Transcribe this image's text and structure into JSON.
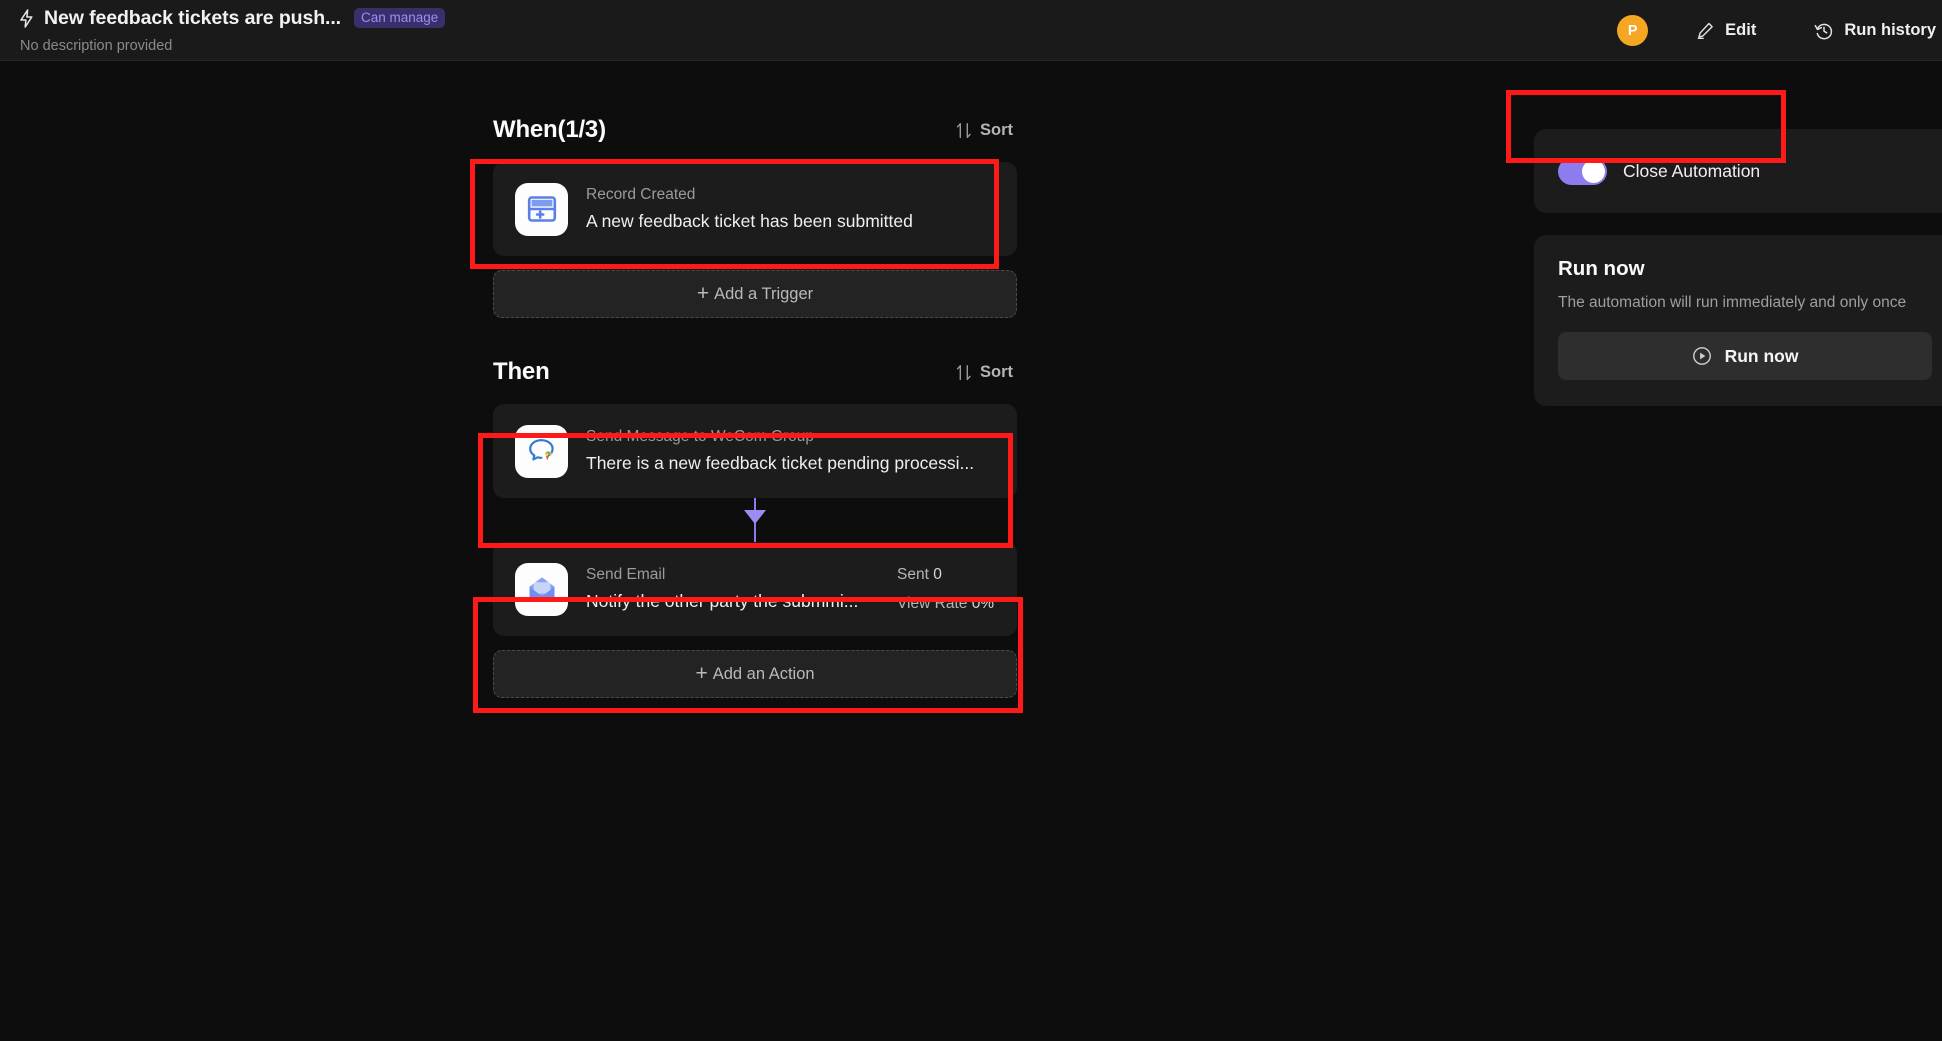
{
  "header": {
    "bolt_icon": "lightning-bolt-icon",
    "title": "New feedback tickets are push...",
    "permission_badge": "Can manage",
    "description": "No description provided",
    "avatar_initial": "P",
    "edit_label": "Edit",
    "edit_icon": "pencil-icon",
    "run_history_label": "Run history",
    "run_history_icon": "history-clock-icon"
  },
  "flow": {
    "when": {
      "title": "When(1/3)",
      "sort_label": "Sort",
      "sort_icon": "sort-arrows-icon",
      "triggers": [
        {
          "icon": "record-created-icon",
          "kind": "Record Created",
          "description": "A new feedback ticket has been submitted"
        }
      ],
      "add_label": "Add a Trigger",
      "add_icon": "plus-icon"
    },
    "then": {
      "title": "Then",
      "sort_label": "Sort",
      "sort_icon": "sort-arrows-icon",
      "actions": [
        {
          "icon": "wecom-chat-icon",
          "kind": "Send Message to WeCom Group",
          "description": "There is a new feedback ticket pending processi...",
          "stats": []
        },
        {
          "icon": "email-envelope-icon",
          "kind": "Send Email",
          "description": "Notify the other party the submmi...",
          "stats": [
            {
              "label": "Sent",
              "value": "0"
            },
            {
              "label": "View Rate",
              "value": "0%"
            }
          ]
        }
      ],
      "add_label": "Add an Action",
      "add_icon": "plus-icon"
    }
  },
  "right_panel": {
    "toggle": {
      "label": "Close Automation",
      "state": "on"
    },
    "run_now": {
      "title": "Run now",
      "subtitle": "The automation will run immediately and only once",
      "button_label": "Run now",
      "button_icon": "play-circle-icon"
    }
  },
  "colors": {
    "accent_purple": "#8c7cf0",
    "badge_text": "#9c8cf5",
    "badge_bg": "#39306b",
    "avatar_bg": "#f5a623",
    "annotation_red": "#ff1a1a",
    "page_bg": "#0d0d0d",
    "card_bg": "#1c1c1c"
  }
}
